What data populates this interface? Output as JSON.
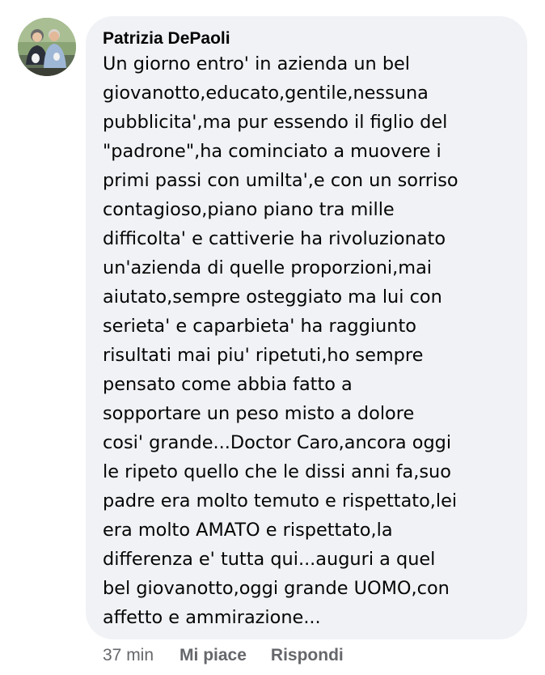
{
  "comment": {
    "author": "Patrizia DePaoli",
    "lines": [
      "Un giorno entro' in azienda un bel",
      "giovanotto,educato,gentile,nessuna",
      "pubblicita',ma pur essendo il figlio del",
      "\"padrone\",ha cominciato a muovere i",
      "primi passi con umilta',e con un sorriso",
      "contagioso,piano piano tra mille",
      "difficolta' e cattiverie ha rivoluzionato",
      "un'azienda di quelle proporzioni,mai",
      "aiutato,sempre osteggiato ma lui con",
      "serieta' e caparbieta' ha raggiunto",
      "risultati mai piu' ripetuti,ho sempre",
      "pensato come abbia fatto a",
      "sopportare un peso misto a dolore",
      "cosi' grande...Doctor Caro,ancora oggi",
      "le ripeto quello che le dissi anni fa,suo",
      "padre era molto temuto e rispettato,lei",
      "era molto AMATO e rispettato,la",
      "differenza e' tutta qui...auguri a quel",
      "bel giovanotto,oggi grande UOMO,con",
      "affetto e ammirazione..."
    ]
  },
  "meta": {
    "timestamp": "37 min",
    "like_label": "Mi piace",
    "reply_label": "Rispondi"
  },
  "colors": {
    "bubble_bg": "#f0f2f5",
    "text": "#050505",
    "meta_text": "#65676b"
  }
}
